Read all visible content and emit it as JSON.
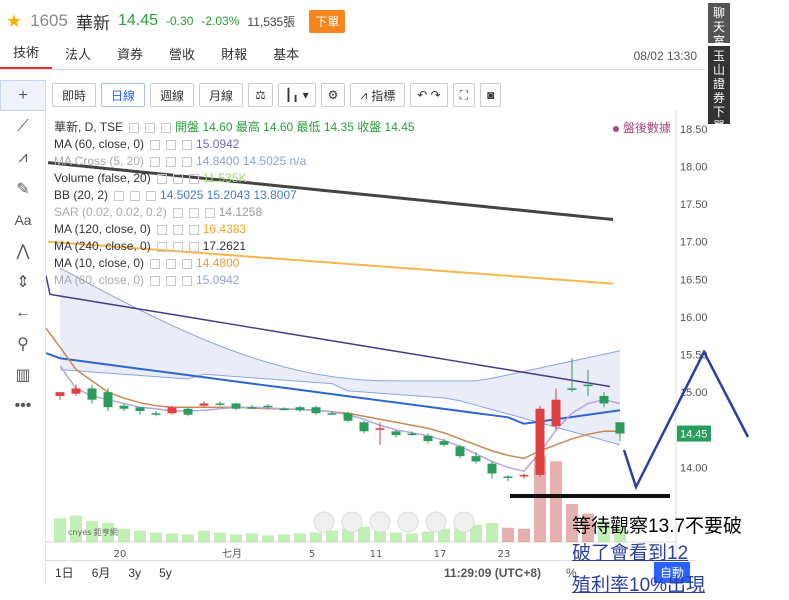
{
  "quote": {
    "code": "1605",
    "name": "華新",
    "price": "14.45",
    "change": "-0.30",
    "change_pct": "-2.03%",
    "volume": "11,535張",
    "order_button": "下單"
  },
  "tabs": [
    "技術",
    "法人",
    "營收",
    "營收",
    "財報",
    "基本"
  ],
  "datetime": "08/02 13:30",
  "side_buttons": {
    "chat": "聊天室",
    "broker_order": "玉山證券下單"
  },
  "toolbar": {
    "intraday": "即時",
    "daily": "日線",
    "weekly": "週線",
    "monthly": "月線",
    "indicators": "指標",
    "icons": [
      "scale-icon",
      "candles-icon",
      "gear-icon",
      "compare-icon",
      "undo-icon",
      "redo-icon",
      "fullscreen-icon",
      "camera-icon"
    ]
  },
  "left_tools": [
    "crosshair-icon",
    "line-icon",
    "fib-icon",
    "brush-icon",
    "text-icon",
    "pattern-icon",
    "measure-icon",
    "arrow-left-icon",
    "zoom-icon",
    "ruler-icon",
    "more-icon"
  ],
  "legend": [
    {
      "label": "華新, D, TSE",
      "values": "開盤 14.60 最高 14.60 最低 14.35 收盤 14.45",
      "color": "#2a9d3c"
    },
    {
      "label": "MA (60, close, 0)",
      "values": "15.0942",
      "color": "#6b6bbf"
    },
    {
      "label": "MA Cross (5, 20)",
      "values": "14.8400  14.5025 n/a",
      "color": "#6b6bbf",
      "fade": true
    },
    {
      "label": "Volume (false, 20)",
      "values": "11.535K",
      "color": "#b7e58b"
    },
    {
      "label": "BB (20, 2)",
      "values": "14.5025  15.2043  13.8007",
      "color": "#4678d8"
    },
    {
      "label": "SAR (0.02, 0.02, 0.2)",
      "values": "14.1258",
      "color": "#999999",
      "fade": true
    },
    {
      "label": "MA (120, close, 0)",
      "values": "16.4383",
      "color": "#f7a21b"
    },
    {
      "label": "MA (240, close, 0)",
      "values": "17.2621",
      "color": "#333333"
    },
    {
      "label": "MA (10, close, 0)",
      "values": "14.4800",
      "color": "#e39b44"
    },
    {
      "label": "MA (60, close, 0)",
      "values": "15.0942",
      "color": "#6b6bbf",
      "fade": true
    }
  ],
  "after_hours": "盤後數據",
  "price_axis": [
    "18.50",
    "18.00",
    "17.50",
    "17.00",
    "16.50",
    "16.00",
    "15.50",
    "15.00",
    "14.50",
    "14.00"
  ],
  "last_price_tag": "14.45",
  "date_axis": [
    "20",
    "七月",
    "5",
    "11",
    "17",
    "23"
  ],
  "ranges": [
    "1日",
    "6月",
    "3y",
    "5y"
  ],
  "clock": "11:29:09 (UTC+8)",
  "bottom_pct": "%",
  "auto_label": "自動",
  "watermark": "cnyes 鉅亨網",
  "annotations": {
    "line1": "等待觀察13.7不要破",
    "line2": "破了會看到12",
    "line3": "殖利率10%出現"
  },
  "chart_data": {
    "type": "candlestick",
    "title": "華新, D, TSE",
    "y_axis_labels": [
      "18.50",
      "18.00",
      "17.50",
      "17.00",
      "16.50",
      "16.00",
      "15.50",
      "15.00",
      "14.50",
      "14.00"
    ],
    "ylim": [
      13.7,
      18.55
    ],
    "x_labels": [
      "20",
      "七月",
      "5",
      "11",
      "17",
      "23"
    ],
    "candles": [
      {
        "o": 14.95,
        "c": 15.0,
        "h": 15.0,
        "l": 14.9
      },
      {
        "o": 14.98,
        "c": 15.05,
        "h": 15.1,
        "l": 14.95
      },
      {
        "o": 15.05,
        "c": 14.9,
        "h": 15.1,
        "l": 14.85
      },
      {
        "o": 15.0,
        "c": 14.8,
        "h": 15.05,
        "l": 14.75
      },
      {
        "o": 14.82,
        "c": 14.78,
        "h": 14.85,
        "l": 14.75
      },
      {
        "o": 14.8,
        "c": 14.75,
        "h": 14.8,
        "l": 14.7
      },
      {
        "o": 14.72,
        "c": 14.72,
        "h": 14.75,
        "l": 14.68
      },
      {
        "o": 14.72,
        "c": 14.8,
        "h": 14.82,
        "l": 14.7
      },
      {
        "o": 14.78,
        "c": 14.7,
        "h": 14.8,
        "l": 14.68
      },
      {
        "o": 14.82,
        "c": 14.85,
        "h": 14.88,
        "l": 14.8
      },
      {
        "o": 14.85,
        "c": 14.85,
        "h": 14.88,
        "l": 14.82
      },
      {
        "o": 14.85,
        "c": 14.78,
        "h": 14.86,
        "l": 14.76
      },
      {
        "o": 14.8,
        "c": 14.8,
        "h": 14.83,
        "l": 14.78
      },
      {
        "o": 14.82,
        "c": 14.8,
        "h": 14.84,
        "l": 14.78
      },
      {
        "o": 14.78,
        "c": 14.78,
        "h": 14.8,
        "l": 14.76
      },
      {
        "o": 14.8,
        "c": 14.76,
        "h": 14.82,
        "l": 14.74
      },
      {
        "o": 14.8,
        "c": 14.72,
        "h": 14.82,
        "l": 14.7
      },
      {
        "o": 14.72,
        "c": 14.72,
        "h": 14.75,
        "l": 14.7
      },
      {
        "o": 14.72,
        "c": 14.62,
        "h": 14.74,
        "l": 14.6
      },
      {
        "o": 14.6,
        "c": 14.48,
        "h": 14.62,
        "l": 14.45
      },
      {
        "o": 14.5,
        "c": 14.52,
        "h": 14.6,
        "l": 14.3
      },
      {
        "o": 14.48,
        "c": 14.43,
        "h": 14.5,
        "l": 14.4
      },
      {
        "o": 14.45,
        "c": 14.43,
        "h": 14.48,
        "l": 14.42
      },
      {
        "o": 14.42,
        "c": 14.35,
        "h": 14.45,
        "l": 14.32
      },
      {
        "o": 14.35,
        "c": 14.3,
        "h": 14.38,
        "l": 14.28
      },
      {
        "o": 14.28,
        "c": 14.15,
        "h": 14.3,
        "l": 14.12
      },
      {
        "o": 14.15,
        "c": 14.08,
        "h": 14.2,
        "l": 14.05
      },
      {
        "o": 14.05,
        "c": 13.92,
        "h": 14.08,
        "l": 13.85
      },
      {
        "o": 13.88,
        "c": 13.88,
        "h": 13.9,
        "l": 13.82
      },
      {
        "o": 13.88,
        "c": 13.9,
        "h": 13.92,
        "l": 13.85
      },
      {
        "o": 13.9,
        "c": 14.78,
        "h": 14.82,
        "l": 13.88
      },
      {
        "o": 14.55,
        "c": 14.9,
        "h": 15.05,
        "l": 14.5
      },
      {
        "o": 15.05,
        "c": 15.05,
        "h": 15.45,
        "l": 15.0
      },
      {
        "o": 15.1,
        "c": 15.1,
        "h": 15.3,
        "l": 14.95
      },
      {
        "o": 14.95,
        "c": 14.85,
        "h": 15.0,
        "l": 14.8
      },
      {
        "o": 14.6,
        "c": 14.45,
        "h": 14.6,
        "l": 14.35
      }
    ],
    "volume": [
      25,
      28,
      22,
      20,
      14,
      12,
      10,
      9,
      8,
      12,
      10,
      8,
      9,
      7,
      8,
      9,
      10,
      12,
      14,
      16,
      12,
      10,
      9,
      11,
      14,
      16,
      18,
      20,
      15,
      14,
      90,
      85,
      40,
      30,
      22,
      18
    ]
  }
}
